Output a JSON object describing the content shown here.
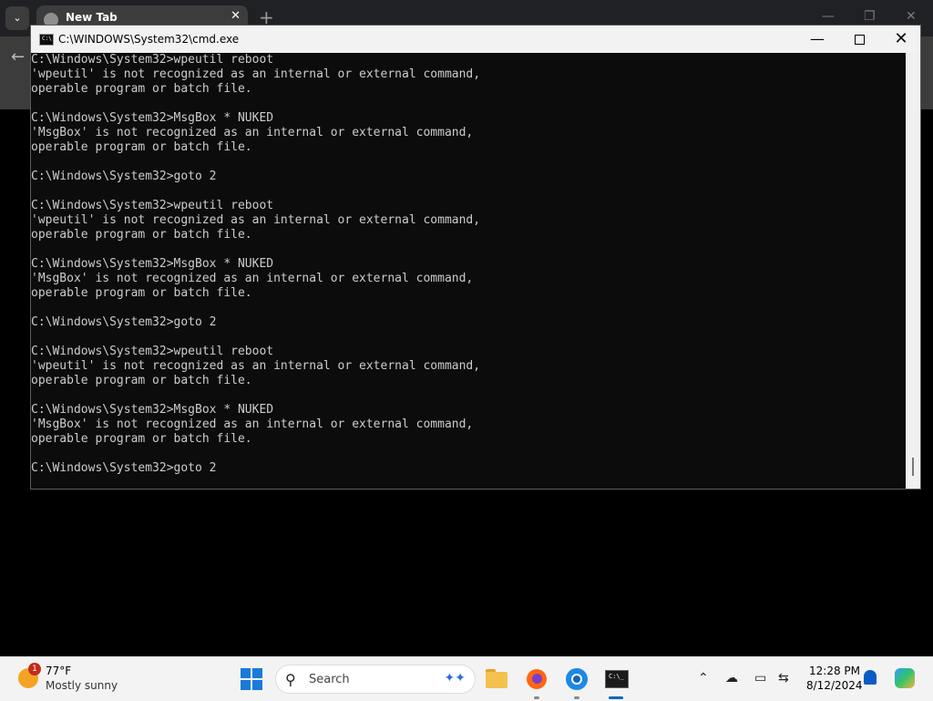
{
  "browser": {
    "tab_title": "New Tab",
    "tab_close": "✕",
    "new_tab": "+",
    "tab_menu": "⌄",
    "back": "←",
    "win_min": "—",
    "win_restore": "❐",
    "win_close": "✕"
  },
  "cmd": {
    "title": "C:\\WINDOWS\\System32\\cmd.exe",
    "icon_glyph": "C:\\",
    "minimize": "—",
    "close": "✕",
    "console_text": "C:\\Windows\\System32>wpeutil reboot\n'wpeutil' is not recognized as an internal or external command,\noperable program or batch file.\n\nC:\\Windows\\System32>MsgBox * NUKED\n'MsgBox' is not recognized as an internal or external command,\noperable program or batch file.\n\nC:\\Windows\\System32>goto 2\n\nC:\\Windows\\System32>wpeutil reboot\n'wpeutil' is not recognized as an internal or external command,\noperable program or batch file.\n\nC:\\Windows\\System32>MsgBox * NUKED\n'MsgBox' is not recognized as an internal or external command,\noperable program or batch file.\n\nC:\\Windows\\System32>goto 2\n\nC:\\Windows\\System32>wpeutil reboot\n'wpeutil' is not recognized as an internal or external command,\noperable program or batch file.\n\nC:\\Windows\\System32>MsgBox * NUKED\n'MsgBox' is not recognized as an internal or external command,\noperable program or batch file.\n\nC:\\Windows\\System32>goto 2"
  },
  "taskbar": {
    "weather_badge": "1",
    "weather_temp": "77°F",
    "weather_condition": "Mostly sunny",
    "search_placeholder": "Search",
    "search_glyph": "⚲",
    "search_deco": "✦✦",
    "terminal_glyph": "C:\\_",
    "tray_chevron": "⌃",
    "tray_cloud": "☁",
    "tray_display": "▭",
    "tray_network": "⇆",
    "time": "12:28 PM",
    "date": "8/12/2024"
  },
  "colors": {
    "console_bg": "#0c0c0c",
    "console_fg": "#cccccc",
    "titlebar": "#f2f2f2",
    "taskbar": "#f3f3f3",
    "accent": "#0067c0"
  }
}
